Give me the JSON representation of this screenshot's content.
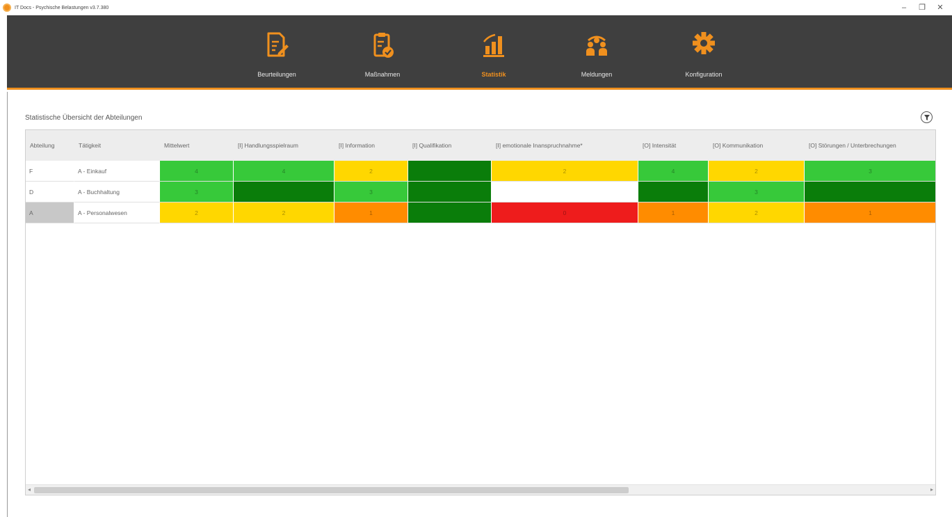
{
  "window": {
    "title": "IT Docs - Psychische Belastungen v3.7.380",
    "controls": {
      "minimize": "–",
      "maximize": "❐",
      "close": "✕"
    }
  },
  "nav": {
    "items": [
      {
        "label": "Beurteilungen",
        "icon": "document-edit-icon",
        "active": false
      },
      {
        "label": "Maßnahmen",
        "icon": "clipboard-check-icon",
        "active": false
      },
      {
        "label": "Statistik",
        "icon": "bar-chart-icon",
        "active": true
      },
      {
        "label": "Meldungen",
        "icon": "people-icon",
        "active": false
      },
      {
        "label": "Konfiguration",
        "icon": "gear-icon",
        "active": false
      }
    ],
    "accent": "#f0901e",
    "background": "#3f3f3f"
  },
  "content": {
    "title": "Statistische Übersicht der Abteilungen",
    "filter_icon": "filter-icon"
  },
  "table": {
    "columns": [
      "Abteilung",
      "Tätigkeit",
      "Mittelwert",
      "[I] Handlungsspielraum",
      "[I] Information",
      "[I] Qualifikation",
      "[I] emotionale Inanspruchnahme*",
      "[O] Intensität",
      "[O] Kommunikation",
      "[O] Störungen / Unterbrechungen"
    ],
    "rows": [
      {
        "abteilung": "F",
        "taetigkeit": "A - Einkauf",
        "values": [
          "4",
          "4",
          "2",
          "",
          "2",
          "4",
          "2",
          "3"
        ],
        "colors": [
          "#37c93a",
          "#37c93a",
          "#ffd700",
          "#0a7d0a",
          "#ffd700",
          "#37c93a",
          "#ffd700",
          "#37c93a"
        ]
      },
      {
        "abteilung": "D",
        "taetigkeit": "A - Buchhaltung",
        "values": [
          "3",
          "",
          "3",
          "",
          "",
          "",
          "3",
          ""
        ],
        "colors": [
          "#37c93a",
          "#0a7d0a",
          "#37c93a",
          "#0a7d0a",
          "#ffffff",
          "#0a7d0a",
          "#37c93a",
          "#0a7d0a"
        ]
      },
      {
        "abteilung": "A",
        "taetigkeit": "A - Personalwesen",
        "values": [
          "2",
          "2",
          "1",
          "",
          "0",
          "1",
          "2",
          "1"
        ],
        "colors": [
          "#ffd700",
          "#ffd700",
          "#ff8c00",
          "#0a7d0a",
          "#ee1c1c",
          "#ff8c00",
          "#ffd700",
          "#ff8c00"
        ]
      }
    ]
  },
  "scrollbar": {
    "left_arrow": "◂",
    "right_arrow": "▸"
  }
}
